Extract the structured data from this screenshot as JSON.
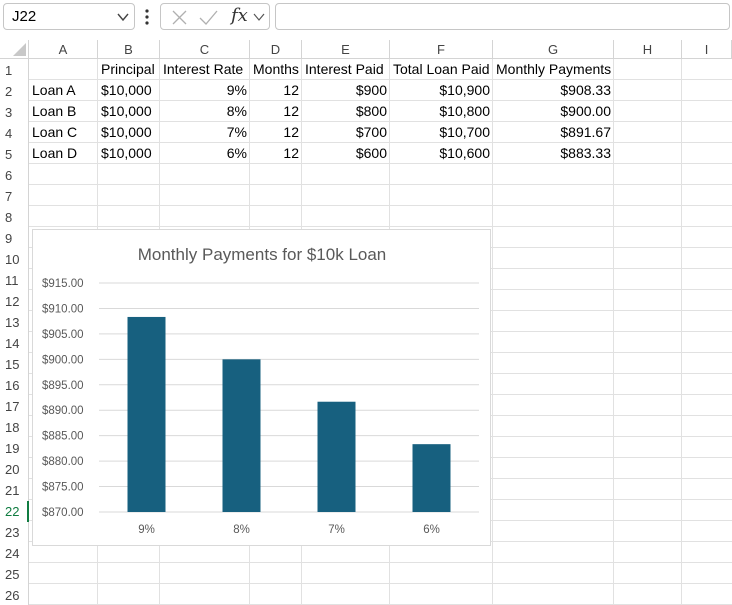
{
  "formula_bar": {
    "name_box": "J22",
    "fx_label": "fx",
    "formula": ""
  },
  "columns": [
    "A",
    "B",
    "C",
    "D",
    "E",
    "F",
    "G",
    "H",
    "I"
  ],
  "rows": [
    "1",
    "2",
    "3",
    "4",
    "5",
    "6",
    "7",
    "8",
    "9",
    "10",
    "11",
    "12",
    "13",
    "14",
    "15",
    "16",
    "17",
    "18",
    "19",
    "20",
    "21",
    "22",
    "23",
    "24",
    "25",
    "26"
  ],
  "active_row": "22",
  "table": {
    "headers": [
      "Principal",
      "Interest Rate",
      "Months",
      "Interest Paid",
      "Total Loan Paid",
      "Monthly Payments"
    ],
    "rows": [
      [
        "Loan A",
        "$10,000",
        "9%",
        "12",
        "$900",
        "$10,900",
        "$908.33"
      ],
      [
        "Loan B",
        "$10,000",
        "8%",
        "12",
        "$800",
        "$10,800",
        "$900.00"
      ],
      [
        "Loan C",
        "$10,000",
        "7%",
        "12",
        "$700",
        "$10,700",
        "$891.67"
      ],
      [
        "Loan D",
        "$10,000",
        "6%",
        "12",
        "$600",
        "$10,600",
        "$883.33"
      ]
    ]
  },
  "colors": {
    "bar": "#17607f",
    "accent": "#107c41"
  },
  "chart_data": {
    "type": "bar",
    "title": "Monthly Payments for $10k Loan",
    "categories": [
      "9%",
      "8%",
      "7%",
      "6%"
    ],
    "values": [
      908.33,
      900.0,
      891.67,
      883.33
    ],
    "ylim": [
      870,
      915
    ],
    "yticks": [
      "$870.00",
      "$875.00",
      "$880.00",
      "$885.00",
      "$890.00",
      "$895.00",
      "$900.00",
      "$905.00",
      "$910.00",
      "$915.00"
    ],
    "ytick_values": [
      870,
      875,
      880,
      885,
      890,
      895,
      900,
      905,
      910,
      915
    ],
    "grid": true,
    "legend": "none"
  }
}
